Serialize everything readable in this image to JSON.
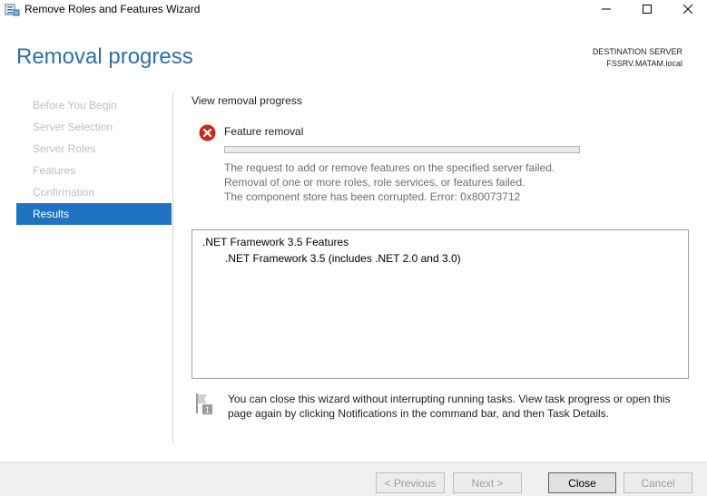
{
  "window": {
    "title": "Remove Roles and Features Wizard"
  },
  "header": {
    "page_title": "Removal progress",
    "destination_label": "DESTINATION SERVER",
    "destination_server": "FSSRV.MATAM.local"
  },
  "nav": {
    "items": [
      {
        "label": "Before You Begin",
        "active": false
      },
      {
        "label": "Server Selection",
        "active": false
      },
      {
        "label": "Server Roles",
        "active": false
      },
      {
        "label": "Features",
        "active": false
      },
      {
        "label": "Confirmation",
        "active": false
      },
      {
        "label": "Results",
        "active": true
      }
    ]
  },
  "main": {
    "section_label": "View removal progress",
    "status": {
      "title": "Feature removal",
      "icon": "error-icon",
      "progress": 0,
      "messages": [
        "The request to add or remove features on the specified server failed.",
        "Removal of one or more roles, role services, or features failed.",
        "The component store has been corrupted. Error: 0x80073712"
      ]
    },
    "results": {
      "feature": ".NET Framework 3.5 Features",
      "sub_feature": ".NET Framework 3.5 (includes .NET 2.0 and 3.0)"
    },
    "notice": "You can close this wizard without interrupting running tasks. View task progress or open this page again by clicking Notifications in the command bar, and then Task Details."
  },
  "footer": {
    "previous_label": "< Previous",
    "next_label": "Next >",
    "close_label": "Close",
    "cancel_label": "Cancel"
  },
  "colors": {
    "accent": "#1f74c2",
    "title_blue": "#2f6fa6",
    "error_red": "#c42b1c"
  }
}
